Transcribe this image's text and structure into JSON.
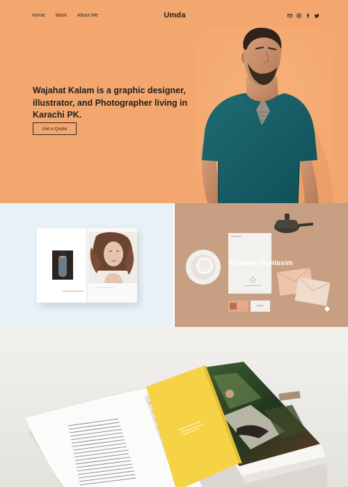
{
  "nav": {
    "links": [
      "Home",
      "Work",
      "About Me"
    ],
    "brand": "Umda",
    "social_icons": [
      "mail-icon",
      "instagram-icon",
      "facebook-icon",
      "twitter-icon"
    ]
  },
  "hero": {
    "headline": "Wajahat Kalam is a graphic designer, illustrator, and Photographer living in Karachi PK.",
    "cta_label": "Get a Quote"
  },
  "portfolio": {
    "tile_2_title": "Quisque dignissim"
  },
  "colors": {
    "hero_bg": "#f3a76e",
    "tile_left_bg": "#e8f1f5",
    "tile_right_bg": "#c79f83",
    "book_cover": "#f6d245"
  }
}
